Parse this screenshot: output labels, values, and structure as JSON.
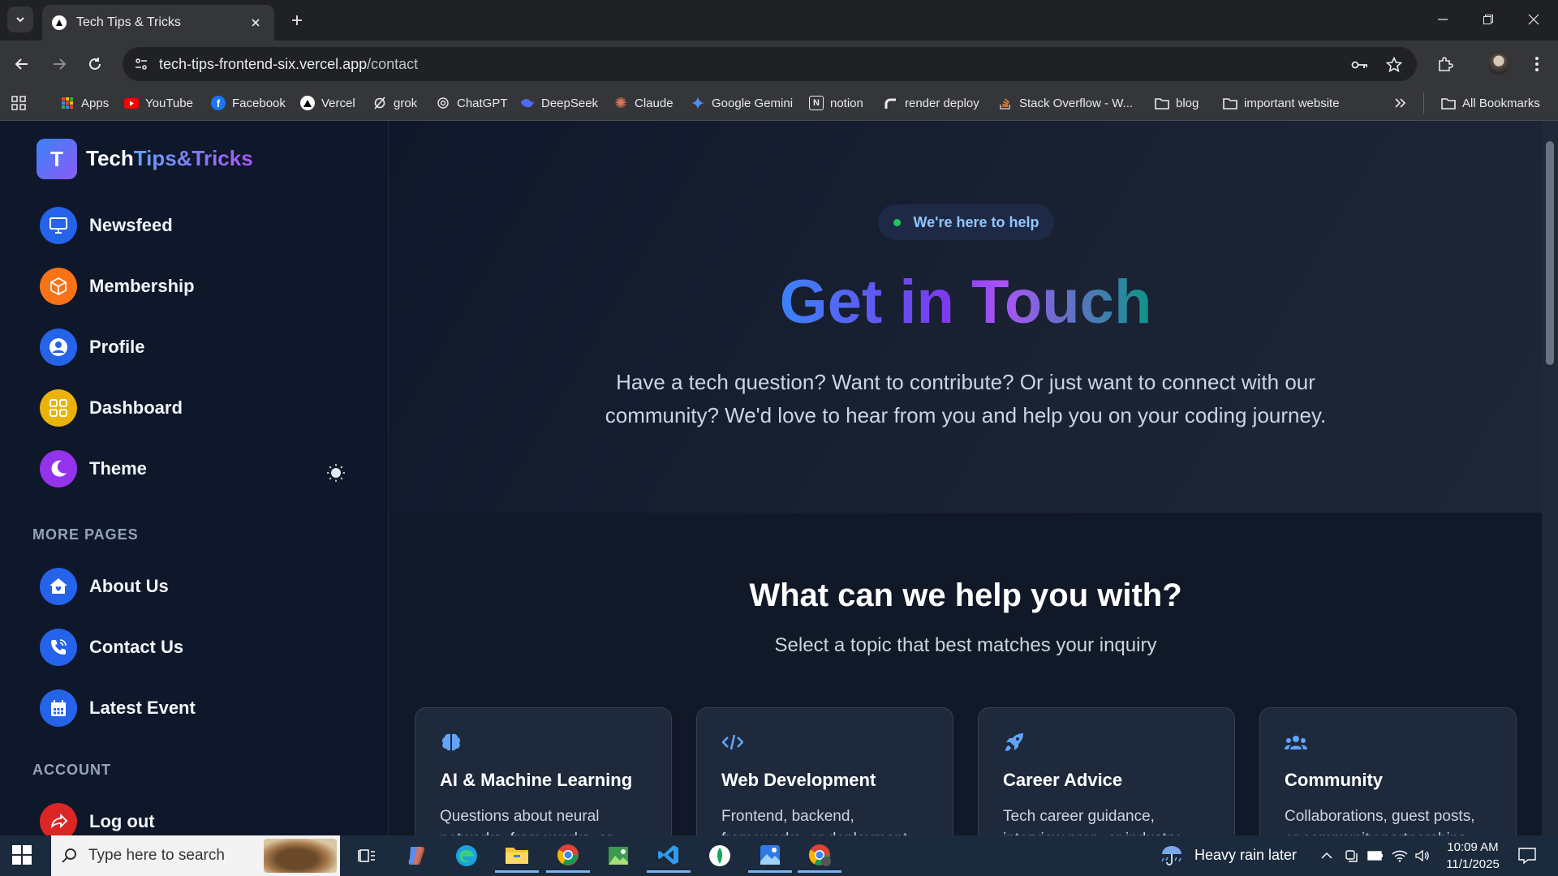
{
  "browser": {
    "tab_title": "Tech Tips & Tricks",
    "url_domain": "tech-tips-frontend-six.vercel.app",
    "url_path": "/contact",
    "bookmarks": [
      {
        "label": "Apps",
        "icon": "apps-grid-icon"
      },
      {
        "label": "YouTube",
        "icon": "youtube-icon"
      },
      {
        "label": "Facebook",
        "icon": "facebook-icon"
      },
      {
        "label": "Vercel",
        "icon": "vercel-icon"
      },
      {
        "label": "grok",
        "icon": "grok-icon"
      },
      {
        "label": "ChatGPT",
        "icon": "chatgpt-icon"
      },
      {
        "label": "DeepSeek",
        "icon": "deepseek-icon"
      },
      {
        "label": "Claude",
        "icon": "claude-icon"
      },
      {
        "label": "Google Gemini",
        "icon": "gemini-icon"
      },
      {
        "label": "notion",
        "icon": "notion-icon"
      },
      {
        "label": "render deploy",
        "icon": "render-icon"
      },
      {
        "label": "Stack Overflow - W...",
        "icon": "stackoverflow-icon"
      },
      {
        "label": "blog",
        "icon": "folder-icon"
      },
      {
        "label": "important website",
        "icon": "folder-icon"
      }
    ],
    "all_bookmarks": "All Bookmarks"
  },
  "sidebar": {
    "logo_letter": "T",
    "logo_part1": "Tech",
    "logo_part2": "Tips&Tricks",
    "items": [
      {
        "label": "Newsfeed",
        "color": "#2563eb"
      },
      {
        "label": "Membership",
        "color": "#f97316"
      },
      {
        "label": "Profile",
        "color": "#2563eb"
      },
      {
        "label": "Dashboard",
        "color": "#eab308"
      },
      {
        "label": "Theme",
        "color": "#9333ea"
      }
    ],
    "more_pages_heading": "MORE PAGES",
    "more_pages": [
      {
        "label": "About Us",
        "color": "#2563eb"
      },
      {
        "label": "Contact Us",
        "color": "#2563eb"
      },
      {
        "label": "Latest Event",
        "color": "#2563eb"
      }
    ],
    "account_heading": "ACCOUNT",
    "logout_label": "Log out"
  },
  "main": {
    "badge": "We're here to help",
    "title": "Get in Touch",
    "subtitle": "Have a tech question? Want to contribute? Or just want to connect with our community? We'd love to hear from you and help you on your coding journey.",
    "help_title": "What can we help you with?",
    "help_subtitle": "Select a topic that best matches your inquiry",
    "cards": [
      {
        "title": "AI & Machine Learning",
        "desc": "Questions about neural networks, frameworks, or",
        "icon": "brain-icon"
      },
      {
        "title": "Web Development",
        "desc": "Frontend, backend, frameworks, or deployment",
        "icon": "code-icon"
      },
      {
        "title": "Career Advice",
        "desc": "Tech career guidance, interview prep, or industry",
        "icon": "rocket-icon"
      },
      {
        "title": "Community",
        "desc": "Collaborations, guest posts, or community partnerships",
        "icon": "users-icon"
      }
    ]
  },
  "taskbar": {
    "search_placeholder": "Type here to search",
    "weather": "Heavy rain later",
    "time": "10:09 AM",
    "date": "11/1/2025"
  }
}
